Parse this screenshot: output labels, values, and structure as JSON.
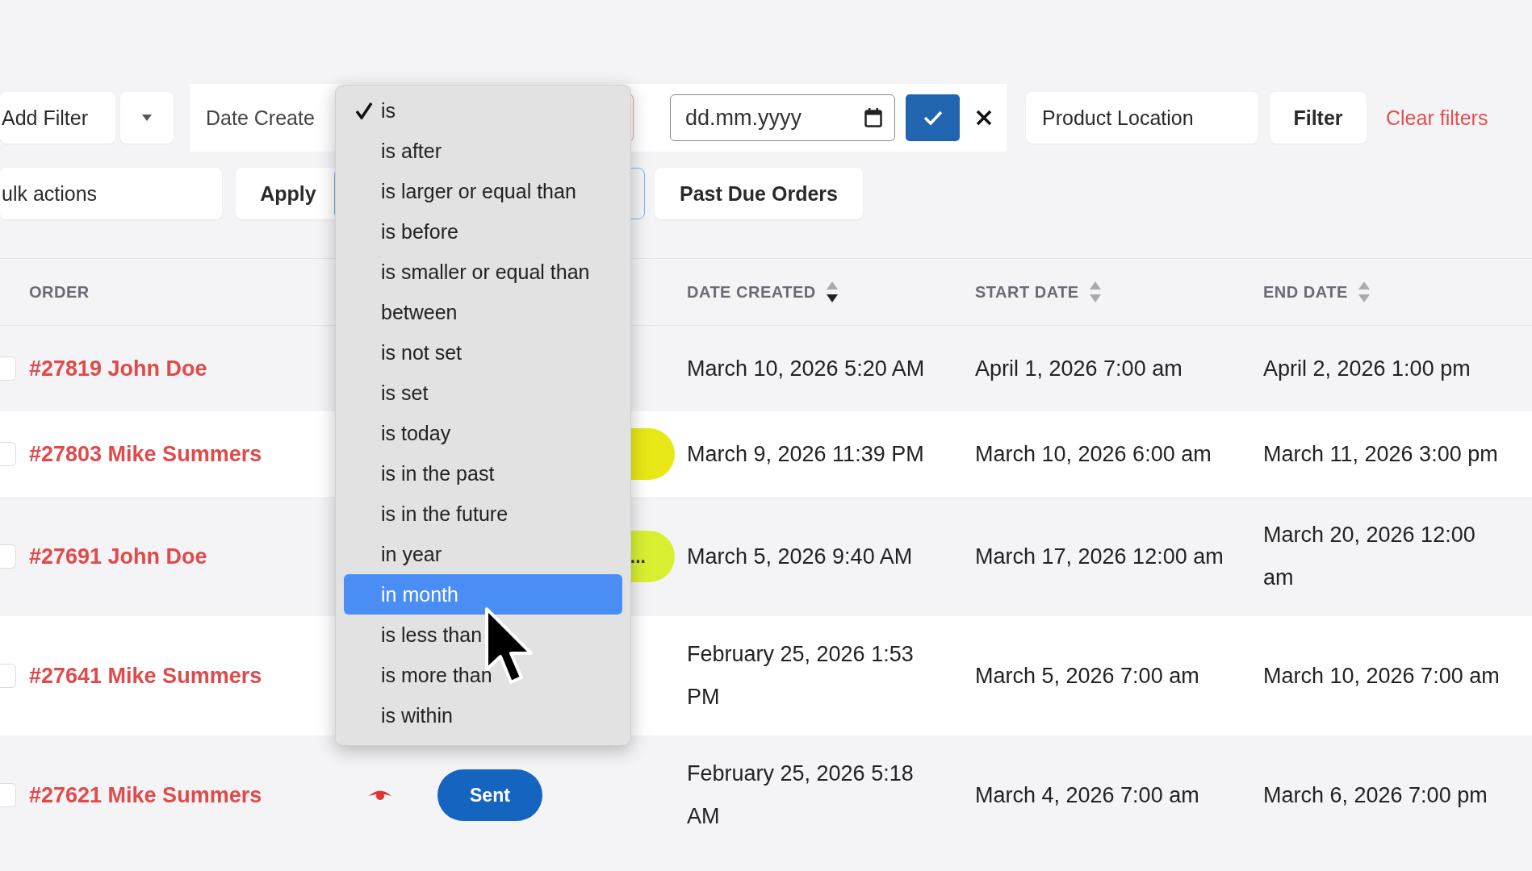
{
  "filter_bar": {
    "add_filter": "Add Filter",
    "field_select": "Date Create",
    "date_input": {
      "placeholder": "dd.mm.yyyy"
    },
    "location_select": "Product Location",
    "filter_button": "Filter",
    "clear_link": "Clear filters"
  },
  "actions_bar": {
    "bulk_select": "ulk actions",
    "apply_button": "Apply",
    "past_due_button": "Past Due Orders"
  },
  "table": {
    "columns": [
      {
        "label": "ORDER"
      },
      {
        "label": "DATE CREATED",
        "sorted": true
      },
      {
        "label": "START DATE",
        "sorted": false
      },
      {
        "label": "END DATE",
        "sorted": false
      }
    ],
    "rows": [
      {
        "checked": false,
        "order": "#27819 John Doe",
        "seen": false,
        "date_created": "March 10, 2026 5:20 AM",
        "start_date": "April 1, 2026 7:00 am",
        "end_date": "April 2, 2026 1:00 pm"
      },
      {
        "checked": false,
        "order": "#27803 Mike Summers",
        "seen": false,
        "status": {
          "kind": "tag",
          "color": "#e8e816"
        },
        "date_created": "March 9, 2026 11:39 PM",
        "start_date": "March 10, 2026 6:00 am",
        "end_date": "March 11, 2026 3:00 pm"
      },
      {
        "checked": false,
        "order": "#27691 John Doe",
        "seen": false,
        "status": {
          "kind": "tag",
          "label": "...",
          "color": "#d9f032"
        },
        "date_created": "March 5, 2026 9:40 AM",
        "start_date": "March 17, 2026 12:00 am",
        "end_date": "March 20, 2026 12:00 am"
      },
      {
        "checked": false,
        "order": "#27641 Mike Summers",
        "seen": false,
        "date_created": "February 25, 2026 1:53 PM",
        "start_date": "March 5, 2026 7:00 am",
        "end_date": "March 10, 2026 7:00 am"
      },
      {
        "checked": false,
        "order": "#27621 Mike Summers",
        "seen": true,
        "status": {
          "kind": "button",
          "label": "Sent",
          "color": "#1565c0"
        },
        "date_created": "February 25, 2026 5:18 AM",
        "start_date": "March 4, 2026 7:00 am",
        "end_date": "March 6, 2026 7:00 pm"
      }
    ]
  },
  "operator_menu": {
    "items": [
      {
        "label": "is",
        "checked": true,
        "selected": false
      },
      {
        "label": "is after",
        "checked": false,
        "selected": false
      },
      {
        "label": "is larger or equal than",
        "checked": false,
        "selected": false
      },
      {
        "label": "is before",
        "checked": false,
        "selected": false
      },
      {
        "label": "is smaller or equal than",
        "checked": false,
        "selected": false
      },
      {
        "label": "between",
        "checked": false,
        "selected": false
      },
      {
        "label": "is not set",
        "checked": false,
        "selected": false
      },
      {
        "label": "is set",
        "checked": false,
        "selected": false
      },
      {
        "label": "is today",
        "checked": false,
        "selected": false
      },
      {
        "label": "is in the past",
        "checked": false,
        "selected": false
      },
      {
        "label": "is in the future",
        "checked": false,
        "selected": false
      },
      {
        "label": "in year",
        "checked": false,
        "selected": false
      },
      {
        "label": "in month",
        "checked": false,
        "selected": true
      },
      {
        "label": "is less than",
        "checked": false,
        "selected": false
      },
      {
        "label": "is more than",
        "checked": false,
        "selected": false
      },
      {
        "label": "is within",
        "checked": false,
        "selected": false
      }
    ]
  }
}
